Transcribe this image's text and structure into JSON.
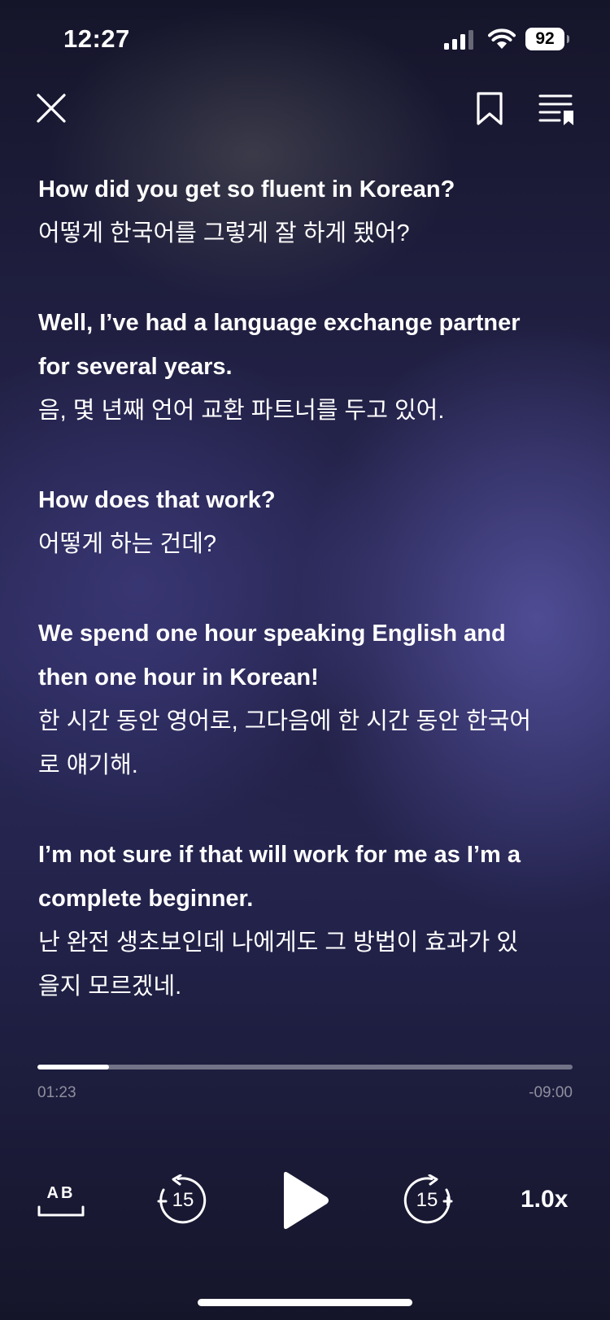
{
  "status_bar": {
    "time": "12:27",
    "battery": "92"
  },
  "transcript": [
    {
      "en": [
        "How did you get so fluent in Korean?"
      ],
      "ko": [
        "어떻게 한국어를 그렇게 잘 하게 됐어?"
      ]
    },
    {
      "en": [
        "Well, I’ve had a language exchange partner",
        "for several years."
      ],
      "ko": [
        "음, 몇 년째 언어 교환 파트너를 두고 있어."
      ]
    },
    {
      "en": [
        "How does that work?"
      ],
      "ko": [
        "어떻게 하는 건데?"
      ]
    },
    {
      "en": [
        "We spend one hour speaking English and",
        "then one hour in Korean!"
      ],
      "ko": [
        "한 시간 동안 영어로, 그다음에 한 시간 동안 한국어",
        "로 얘기해."
      ]
    },
    {
      "en": [
        "I’m not sure if that will work for me as I’m a",
        "complete beginner."
      ],
      "ko": [
        "난 완전 생초보인데 나에게도 그 방법이 효과가 있",
        "을지 모르겠네."
      ]
    }
  ],
  "player": {
    "progress_fraction": 0.133,
    "elapsed": "01:23",
    "remaining": "-09:00",
    "ab_label": "AB",
    "rewind_label": "15",
    "forward_label": "15",
    "speed": "1.0x"
  },
  "icons": {
    "close": "close-icon",
    "bookmark": "bookmark-icon",
    "playlist": "playlist-icon",
    "play": "play-icon"
  }
}
